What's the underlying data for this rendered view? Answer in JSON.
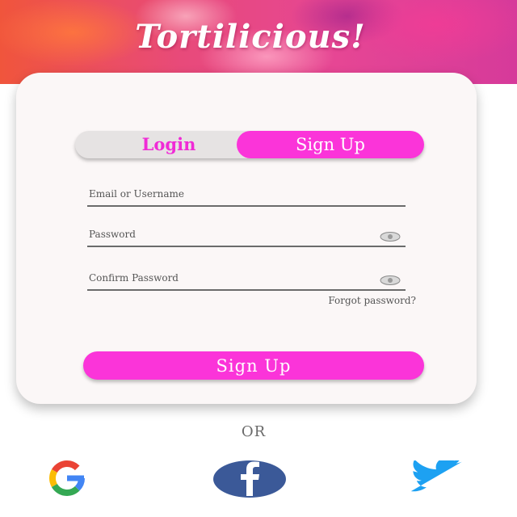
{
  "header": {
    "app_title": "Tortilicious!"
  },
  "auth_tabs": {
    "login_label": "Login",
    "signup_label": "Sign Up",
    "active": "signup"
  },
  "form": {
    "email_placeholder": "Email or Username",
    "password_placeholder": "Password",
    "confirm_placeholder": "Confirm Password",
    "forgot_label": "Forgot password?",
    "submit_label": "Sign Up"
  },
  "divider": {
    "or_label": "OR"
  },
  "social": [
    {
      "name": "google-icon"
    },
    {
      "name": "facebook-icon"
    },
    {
      "name": "twitter-icon"
    }
  ],
  "colors": {
    "accent": "#fb34d9",
    "login_text": "#f02bd6",
    "card_bg": "#fbf7f7",
    "facebook": "#3b5998",
    "twitter": "#1da1f2"
  }
}
